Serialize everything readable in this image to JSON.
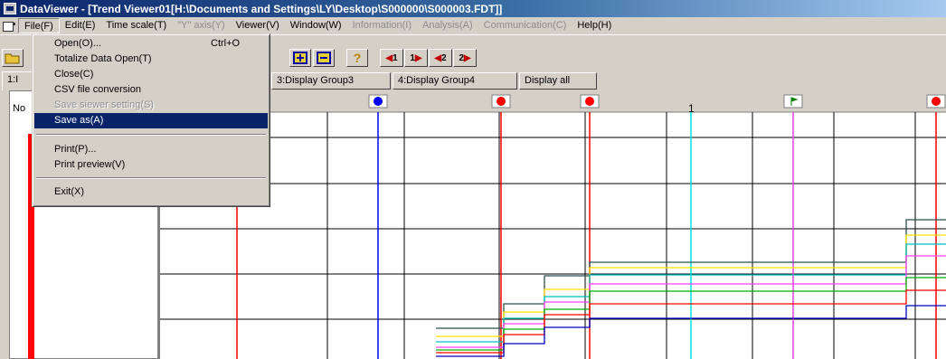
{
  "title": "DataViewer - [Trend Viewer01[H:\\Documents and Settings\\LY\\Desktop\\S000000\\S000003.FDT]]",
  "menu": [
    {
      "label": "File(F)",
      "disabled": false
    },
    {
      "label": "Edit(E)",
      "disabled": false
    },
    {
      "label": "Time scale(T)",
      "disabled": false
    },
    {
      "label": "\"Y\" axis(Y)",
      "disabled": true
    },
    {
      "label": "Viewer(V)",
      "disabled": false
    },
    {
      "label": "Window(W)",
      "disabled": false
    },
    {
      "label": "Information(I)",
      "disabled": true
    },
    {
      "label": "Analysis(A)",
      "disabled": true
    },
    {
      "label": "Communication(C)",
      "disabled": true
    },
    {
      "label": "Help(H)",
      "disabled": false
    }
  ],
  "file_menu": {
    "open": "Open(O)...",
    "open_shortcut": "Ctrl+O",
    "totalize": "Totalize Data Open(T)",
    "close": "Close(C)",
    "csv": "CSV file conversion",
    "save_viewer": "Save siewer setting(S)",
    "save_as": "Save as(A)",
    "print": "Print(P)...",
    "print_preview": "Print preview(V)",
    "exit": "Exit(X)"
  },
  "toolbar": {
    "cursor1_label": "1",
    "cursor1b_label": "1",
    "cursor2_label": "2",
    "cursor2b_label": "2",
    "help_symbol": "?"
  },
  "tabs": {
    "tab1": "1:I",
    "tab3": "3:Display Group3",
    "tab4": "4:Display Group4",
    "all": "Display all"
  },
  "left_panel_label": "No",
  "marker_label": "1",
  "colors": {
    "title_start": "#0a246a",
    "highlight": "#0a246a",
    "marker_blue": "#0000ff",
    "marker_red": "#ff0000"
  }
}
